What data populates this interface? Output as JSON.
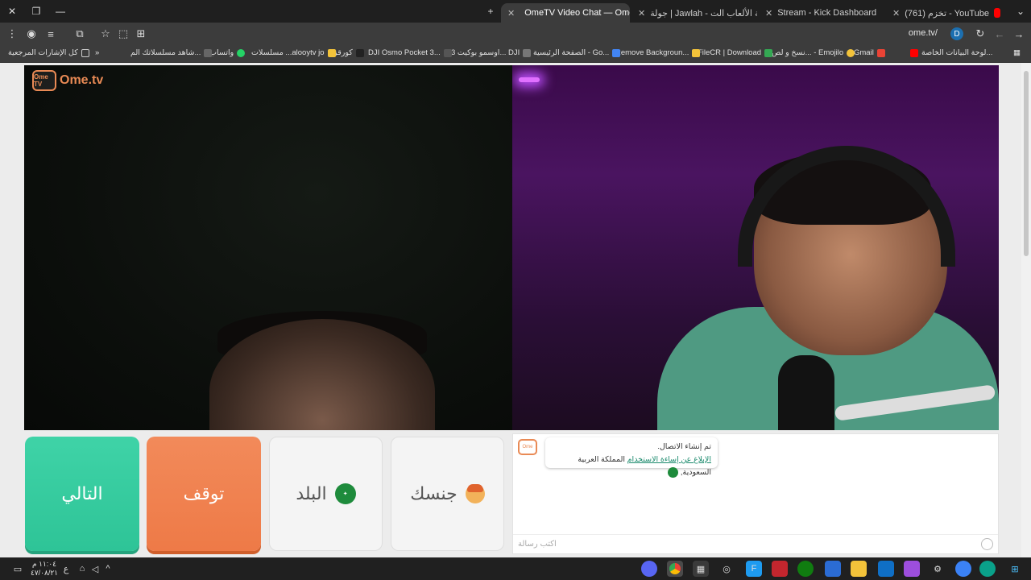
{
  "tabs": [
    {
      "title": "(761) تخزم - YouTube",
      "favicon_color": "#ff0000",
      "active": false
    },
    {
      "title": "Stream - Kick Dashboard",
      "favicon_color": "#53fc18",
      "active": false
    },
    {
      "title": "جولة | Jawlah - منصة الألعاب الت",
      "favicon_color": "#ffffff",
      "active": false
    },
    {
      "title": "OmeTV Video Chat — Ome",
      "favicon_color": "#e98a55",
      "active": true
    }
  ],
  "toolbar": {
    "url": "ome.tv/",
    "profile_letter": "D"
  },
  "bookmarks": [
    "لوحة البيانات الخاصة...",
    "Gmail",
    "نسخ و لص... - Emojilo",
    "FileCR | Download",
    "Remove Backgroun...",
    "الصفحة الرئيسية - Go...",
    "اوسمو بوكيت 3... DJI",
    "DJI Osmo Pocket 3...",
    "كورقز",
    "مسلسلات ...alooytv jo",
    "واتساب",
    "شاهد مسلسلاتك الم...",
    "كل الإشارات المرجعية"
  ],
  "logo": {
    "text": "Ome.tv",
    "badge": "Ome TV"
  },
  "buttons": {
    "next": "التالي",
    "stop": "توقف",
    "country": "البلد",
    "gender": "جنسك"
  },
  "chat": {
    "line1": "تم إنشاء الاتصال.",
    "link": "الإبلاغ عن إساءة الاستخدام",
    "country": "المملكة العربية السعودية,",
    "placeholder": "اكتب رسالة"
  },
  "taskbar": {
    "time": "١١:٠٤ م",
    "date": "٤٧/٠٨/٢١",
    "lang": "ع"
  }
}
